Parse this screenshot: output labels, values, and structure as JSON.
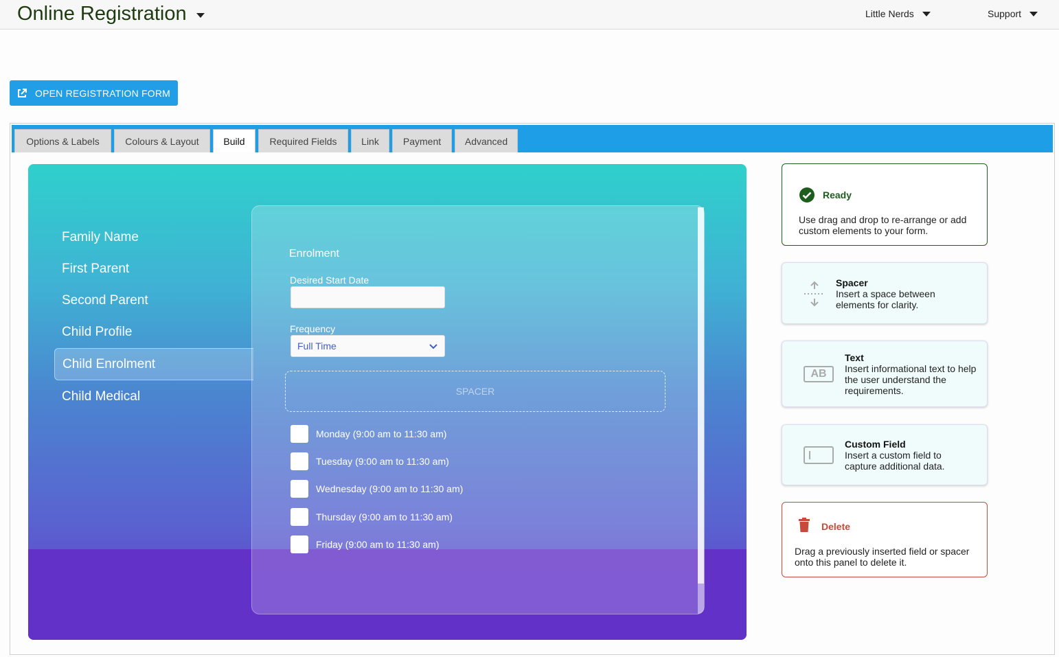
{
  "header": {
    "app_title": "Online Registration",
    "account_menu": "Little Nerds",
    "support_menu": "Support"
  },
  "open_form_button": "OPEN REGISTRATION FORM",
  "tabs": [
    {
      "label": "Options & Labels",
      "active": false
    },
    {
      "label": "Colours & Layout",
      "active": false
    },
    {
      "label": "Build",
      "active": true
    },
    {
      "label": "Required Fields",
      "active": false
    },
    {
      "label": "Link",
      "active": false
    },
    {
      "label": "Payment",
      "active": false
    },
    {
      "label": "Advanced",
      "active": false
    }
  ],
  "preview": {
    "nav": [
      "Family Name",
      "First Parent",
      "Second Parent",
      "Child Profile",
      "Child Enrolment",
      "Child Medical"
    ],
    "active_nav": "Child Enrolment",
    "section_title": "Enrolment",
    "start_date_label": "Desired Start Date",
    "start_date_value": "",
    "frequency_label": "Frequency",
    "frequency_value": "Full Time",
    "spacer_label": "SPACER",
    "days": [
      "Monday (9:00 am to 11:30 am)",
      "Tuesday (9:00 am to 11:30 am)",
      "Wednesday (9:00 am to 11:30 am)",
      "Thursday (9:00 am to 11:30 am)",
      "Friday (9:00 am to 11:30 am)"
    ]
  },
  "tools": {
    "ready_title": "Ready",
    "ready_desc": "Use drag and drop to re-arrange or add custom elements to your form.",
    "spacer_title": "Spacer",
    "spacer_desc": "Insert a space between elements for clarity.",
    "text_title": "Text",
    "text_desc": "Insert informational text to help the user understand the requirements.",
    "text_icon_text": "AB",
    "custom_title": "Custom Field",
    "custom_desc": "Insert a custom field to capture additional data.",
    "delete_title": "Delete",
    "delete_desc": "Drag a previously inserted field or spacer onto this panel to delete it."
  },
  "colors": {
    "accent": "#219ee5",
    "ready_green": "#1d5d1d",
    "delete_red": "#c94a3a"
  }
}
